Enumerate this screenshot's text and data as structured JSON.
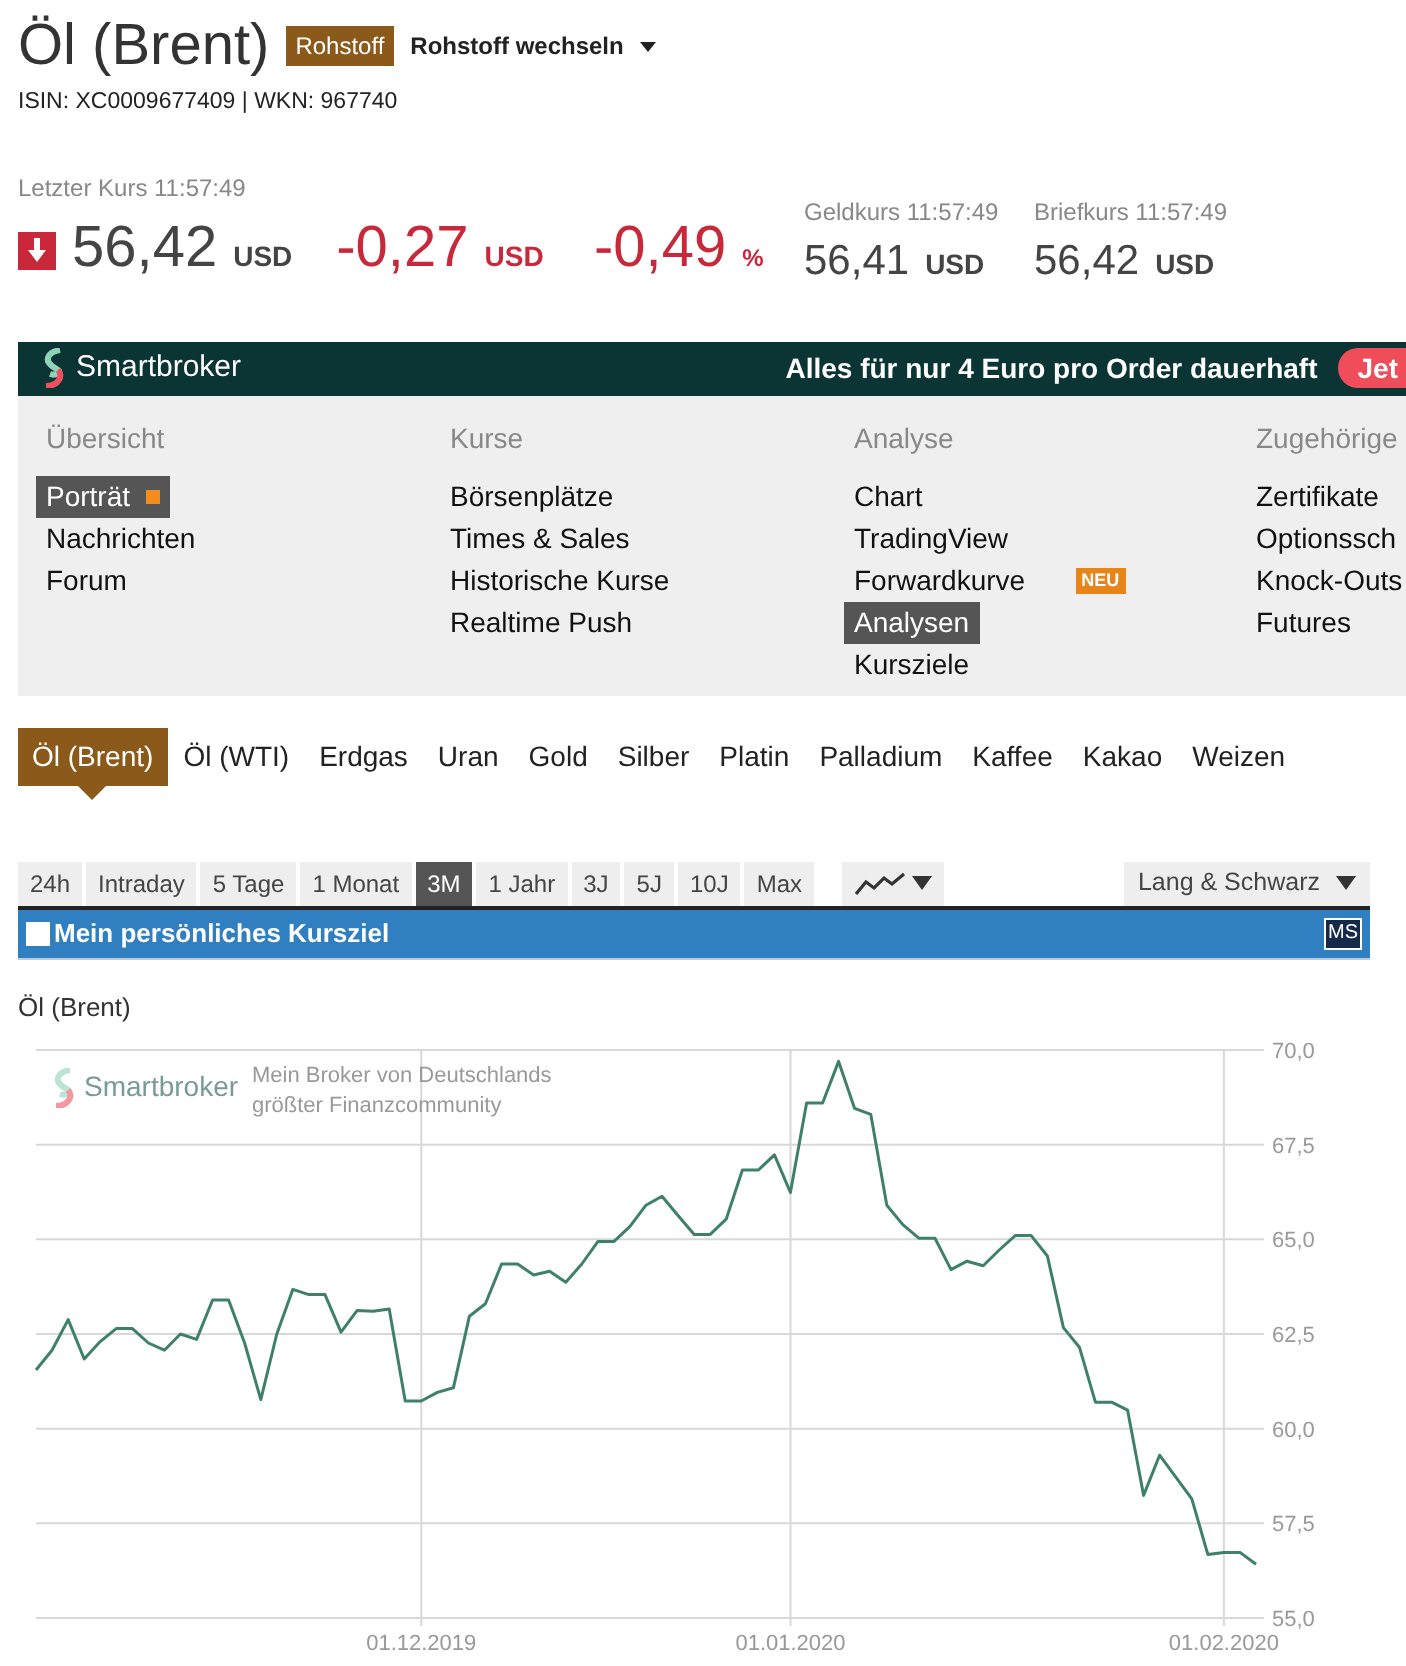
{
  "header": {
    "title": "Öl (Brent)",
    "badge": "Rohstoff",
    "switch_label": "Rohstoff wechseln",
    "identifiers": "ISIN: XC0009677409 | WKN: 967740"
  },
  "quotes": {
    "last": {
      "label": "Letzter Kurs 11:57:49",
      "value": "56,42",
      "unit": "USD",
      "falling": true
    },
    "change_abs": {
      "value": "-0,27",
      "unit": "USD"
    },
    "change_pct": {
      "value": "-0,49",
      "unit": "%"
    },
    "bid": {
      "label": "Geldkurs 11:57:49",
      "value": "56,41",
      "unit": "USD"
    },
    "ask": {
      "label": "Briefkurs 11:57:49",
      "value": "56,42",
      "unit": "USD"
    }
  },
  "banner": {
    "brand": "Smartbroker",
    "slogan": "Alles für nur 4 Euro pro Order dauerhaft",
    "button": "Jet"
  },
  "menu": [
    {
      "heading": "Übersicht",
      "items": [
        {
          "label": "Porträt",
          "selected": true
        },
        {
          "label": "Nachrichten",
          "selected": false
        },
        {
          "label": "Forum",
          "selected": false
        }
      ]
    },
    {
      "heading": "Kurse",
      "items": [
        {
          "label": "Börsenplätze",
          "selected": false
        },
        {
          "label": "Times & Sales",
          "selected": false
        },
        {
          "label": "Historische Kurse",
          "selected": false
        },
        {
          "label": "Realtime Push",
          "selected": false
        }
      ]
    },
    {
      "heading": "Analyse",
      "items": [
        {
          "label": "Chart",
          "selected": false
        },
        {
          "label": "TradingView",
          "selected": false
        },
        {
          "label": "Forwardkurve",
          "selected": false,
          "badge": "NEU"
        },
        {
          "label": "Analysen",
          "selected": true
        },
        {
          "label": "Kursziele",
          "selected": false
        }
      ]
    },
    {
      "heading": "Zugehörige",
      "items": [
        {
          "label": "Zertifikate",
          "selected": false
        },
        {
          "label": "Optionssch",
          "selected": false
        },
        {
          "label": "Knock-Outs",
          "selected": false
        },
        {
          "label": "Futures",
          "selected": false
        }
      ]
    }
  ],
  "commodity_tabs": [
    {
      "label": "Öl (Brent)",
      "selected": true
    },
    {
      "label": "Öl (WTI)",
      "selected": false
    },
    {
      "label": "Erdgas",
      "selected": false
    },
    {
      "label": "Uran",
      "selected": false
    },
    {
      "label": "Gold",
      "selected": false
    },
    {
      "label": "Silber",
      "selected": false
    },
    {
      "label": "Platin",
      "selected": false
    },
    {
      "label": "Palladium",
      "selected": false
    },
    {
      "label": "Kaffee",
      "selected": false
    },
    {
      "label": "Kakao",
      "selected": false
    },
    {
      "label": "Weizen",
      "selected": false
    }
  ],
  "periods": [
    {
      "label": "24h",
      "selected": false
    },
    {
      "label": "Intraday",
      "selected": false
    },
    {
      "label": "5 Tage",
      "selected": false
    },
    {
      "label": "1 Monat",
      "selected": false
    },
    {
      "label": "3M",
      "selected": true
    },
    {
      "label": "1 Jahr",
      "selected": false
    },
    {
      "label": "3J",
      "selected": false
    },
    {
      "label": "5J",
      "selected": false
    },
    {
      "label": "10J",
      "selected": false
    },
    {
      "label": "Max",
      "selected": false
    }
  ],
  "exchange_select": "Lang & Schwarz",
  "target_bar": {
    "label": "Mein persönliches Kursziel",
    "checked": false,
    "badge": "MS"
  },
  "chart": {
    "heading": "Öl (Brent)",
    "watermark_brand": "Smartbroker",
    "watermark_text": "Mein Broker von Deutschlands größter Finanzcommunity",
    "chart_data": {
      "type": "line",
      "categories": [
        null,
        null,
        null,
        null,
        null,
        null,
        null,
        null,
        null,
        null,
        null,
        null,
        null,
        null,
        null,
        null,
        null,
        null,
        null,
        null,
        null,
        null,
        null,
        null,
        "01.12.2019",
        null,
        null,
        null,
        null,
        null,
        null,
        null,
        null,
        null,
        null,
        null,
        null,
        null,
        null,
        null,
        null,
        null,
        null,
        null,
        null,
        null,
        null,
        "01.01.2020",
        null,
        null,
        null,
        null,
        null,
        null,
        null,
        null,
        null,
        null,
        null,
        null,
        null,
        null,
        null,
        null,
        null,
        null,
        null,
        null,
        null,
        null,
        null,
        null,
        null,
        null,
        "01.02.2020",
        null,
        null
      ],
      "series": [
        {
          "color": "#3f8068",
          "values": [
            61.55,
            62.07,
            62.88,
            61.84,
            62.3,
            62.64,
            62.64,
            62.26,
            62.07,
            62.5,
            62.36,
            63.4,
            63.4,
            62.26,
            60.77,
            62.5,
            63.68,
            63.54,
            63.54,
            62.55,
            63.12,
            63.1,
            63.16,
            60.73,
            60.73,
            60.96,
            61.08,
            62.97,
            63.3,
            64.35,
            64.35,
            64.06,
            64.16,
            63.87,
            64.35,
            64.94,
            64.94,
            65.34,
            65.9,
            66.14,
            65.62,
            65.13,
            65.13,
            65.53,
            66.83,
            66.83,
            67.23,
            66.24,
            68.6,
            68.6,
            69.7,
            68.46,
            68.3,
            65.9,
            65.39,
            65.03,
            65.03,
            64.2,
            64.42,
            64.3,
            64.72,
            65.1,
            65.1,
            64.56,
            62.67,
            62.15,
            60.7,
            60.7,
            60.49,
            58.24,
            59.3,
            58.72,
            58.15,
            56.68,
            56.73,
            56.73,
            56.42
          ]
        }
      ],
      "grid": true,
      "ylim": [
        55,
        70
      ],
      "yticks": [
        {
          "value": 55,
          "label": "55,0"
        },
        {
          "value": 57.5,
          "label": "57,5"
        },
        {
          "value": 60,
          "label": "60,0"
        },
        {
          "value": 62.5,
          "label": "62,5"
        },
        {
          "value": 65,
          "label": "65,0"
        },
        {
          "value": 67.5,
          "label": "67,5"
        },
        {
          "value": 70,
          "label": "70,0"
        }
      ]
    }
  }
}
